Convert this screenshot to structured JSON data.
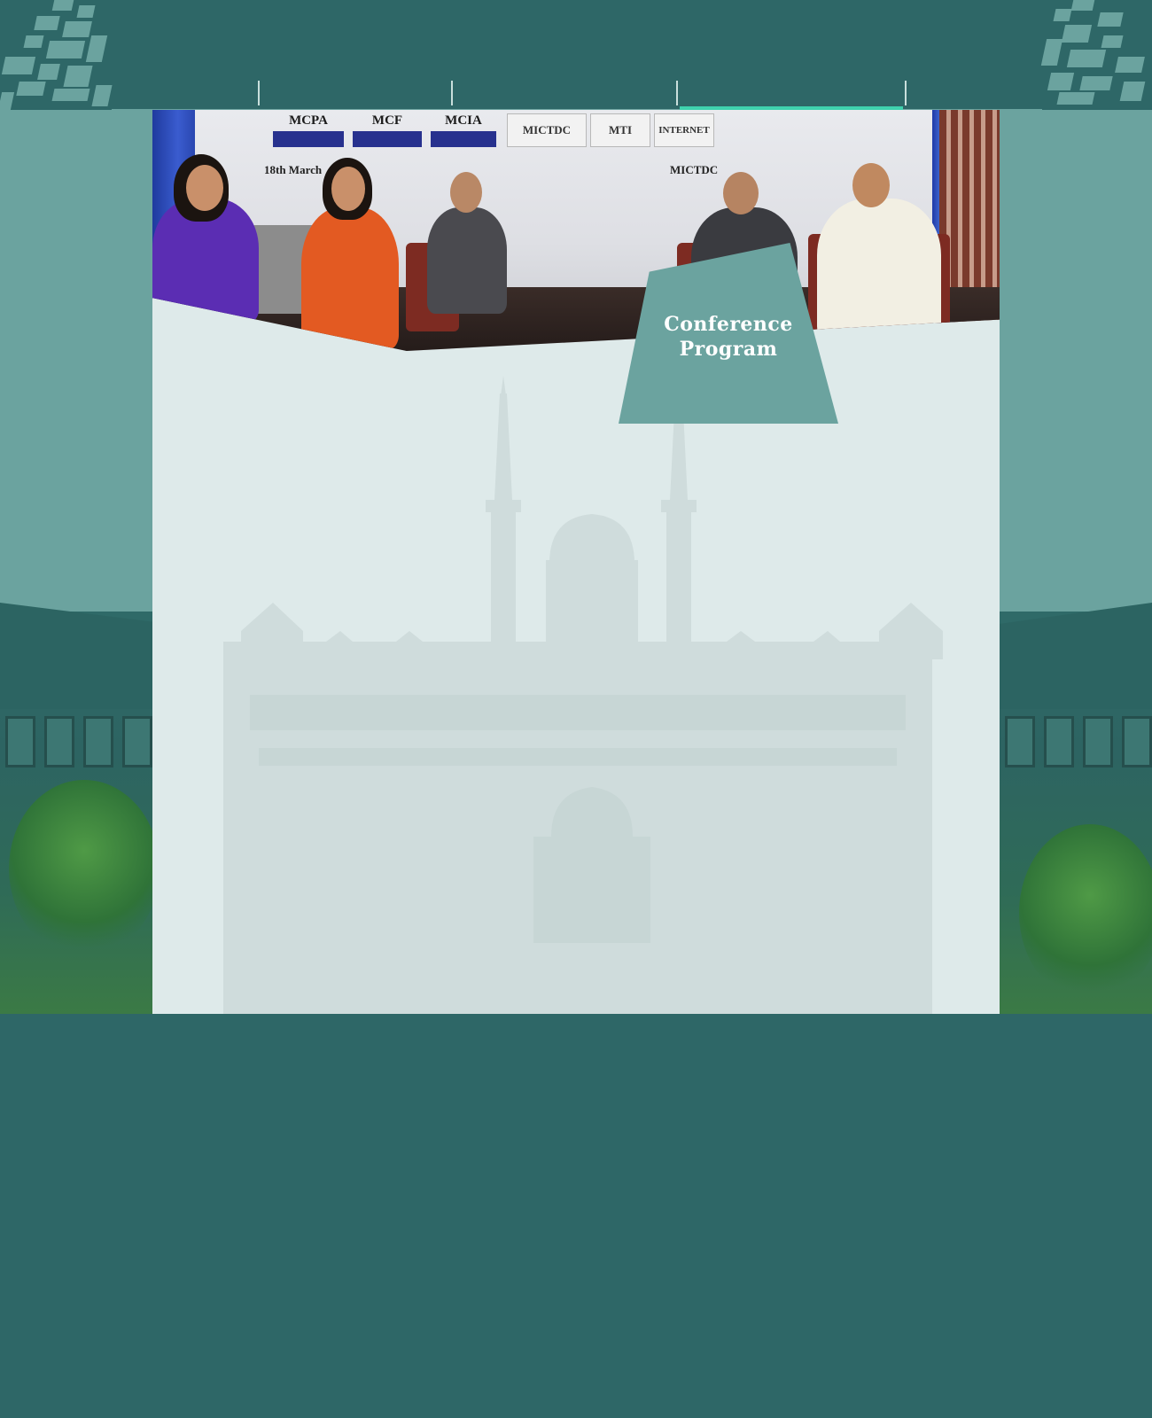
{
  "nav": {
    "items": [
      "",
      "",
      "",
      "",
      ""
    ],
    "active_index": 3
  },
  "banner": {
    "title_line1": "Conference",
    "title_line2": "Program",
    "sponsors": [
      "MCPA",
      "MCF",
      "MCIA"
    ],
    "logos": [
      "MICTDC",
      "MTI",
      "INTERNET"
    ],
    "date_text": "18th March",
    "org_text": "MICTDC"
  },
  "colors": {
    "header": "#2e6767",
    "accent": "#3fd2ae",
    "panel": "#6ba39f",
    "content_bg": "#deeaea"
  }
}
